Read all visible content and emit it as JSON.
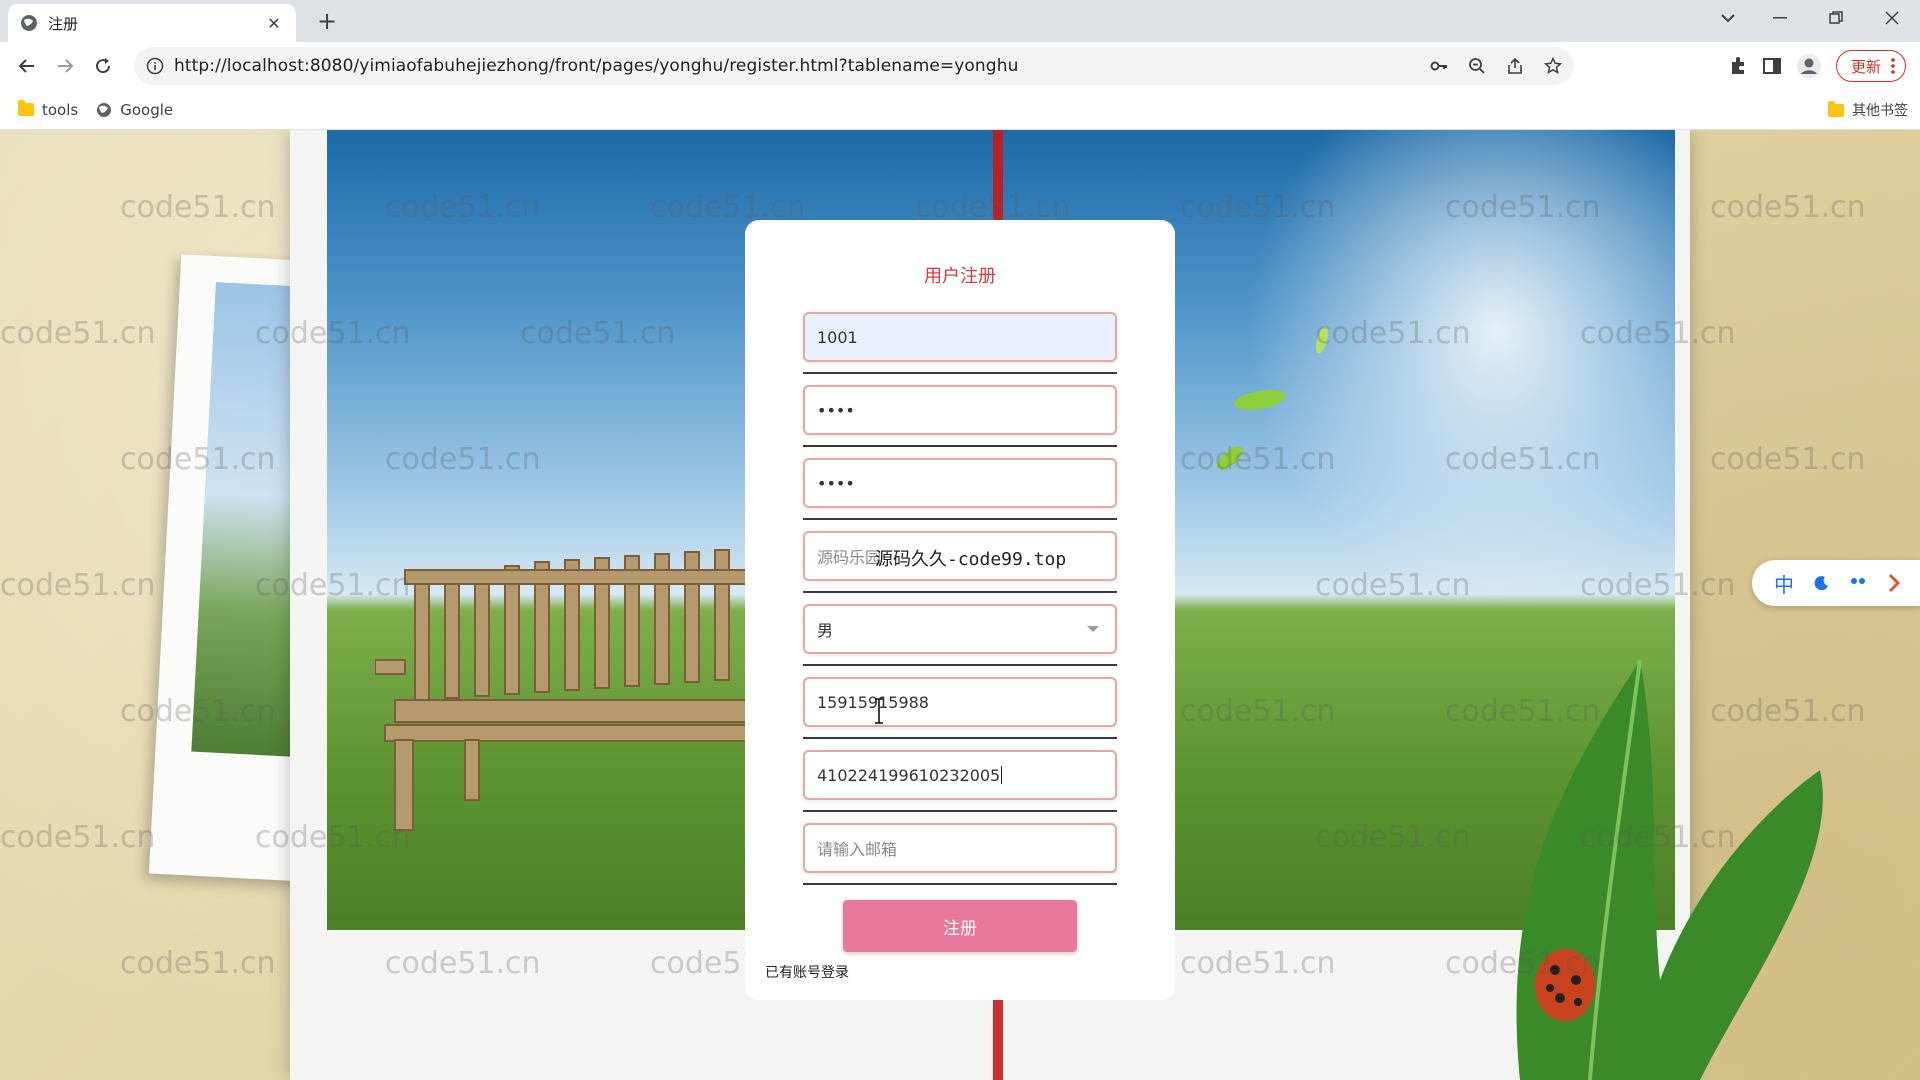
{
  "browser": {
    "tab_title": "注册",
    "url": "http://localhost:8080/yimiaofabuhejiezhong/front/pages/yonghu/register.html?tablename=yonghu",
    "update_label": "更新",
    "bookmarks": [
      {
        "label": "tools"
      },
      {
        "label": "Google"
      }
    ],
    "other_bookmarks": "其他书签"
  },
  "watermark_text": "code51.cn",
  "form": {
    "title": "用户注册",
    "account_value": "1001",
    "password_value": "••••",
    "confirm_password_value": "••••",
    "name_value": "源码乐园",
    "overlay_watermark": "源码久久-code99.top",
    "gender_value": "男",
    "phone_value": "15915915988",
    "id_card_value": "410224199610232005",
    "email_placeholder": "请输入邮箱",
    "submit_label": "注册",
    "login_link": "已有账号登录"
  },
  "ime": {
    "mode": "中"
  },
  "colors": {
    "title_red": "#d8393f",
    "button_pink": "#e9799a",
    "field_border": "#e3a9a2"
  }
}
